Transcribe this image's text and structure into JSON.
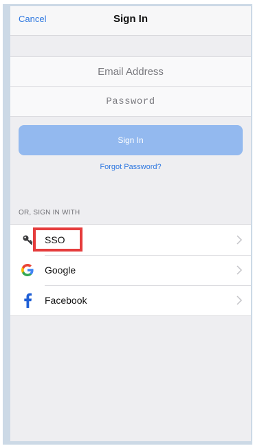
{
  "navbar": {
    "cancel_label": "Cancel",
    "title": "Sign In"
  },
  "form": {
    "email_placeholder": "Email Address",
    "password_placeholder": "Password",
    "signin_label": "Sign In",
    "forgot_label": "Forgot Password?"
  },
  "section": {
    "label": "OR, SIGN IN WITH"
  },
  "providers": [
    {
      "label": "SSO",
      "icon": "key-icon"
    },
    {
      "label": "Google",
      "icon": "google-icon"
    },
    {
      "label": "Facebook",
      "icon": "facebook-icon"
    }
  ],
  "colors": {
    "accent": "#2f78e0",
    "signin_button": "#93b9ef",
    "highlight": "#e53c3c",
    "facebook": "#1f5fd6"
  }
}
